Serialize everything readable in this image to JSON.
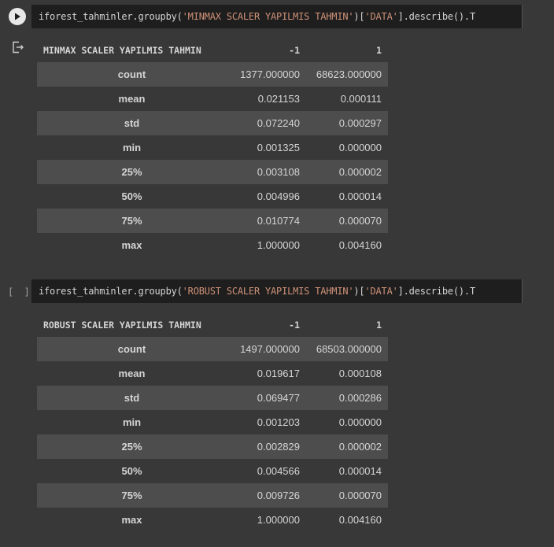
{
  "cells": [
    {
      "code": {
        "prefix": "iforest_tahminler.groupby(",
        "arg1": "'MINMAX SCALER YAPILMIS TAHMIN'",
        "mid": ")[",
        "arg2": "'DATA'",
        "suffix": "].describe().T"
      },
      "run_state": "play",
      "table": {
        "index_name": "MINMAX SCALER YAPILMIS TAHMIN",
        "columns": [
          "-1",
          "1"
        ],
        "rows": [
          {
            "label": "count",
            "v1": "1377.000000",
            "v2": "68623.000000"
          },
          {
            "label": "mean",
            "v1": "0.021153",
            "v2": "0.000111"
          },
          {
            "label": "std",
            "v1": "0.072240",
            "v2": "0.000297"
          },
          {
            "label": "min",
            "v1": "0.001325",
            "v2": "0.000000"
          },
          {
            "label": "25%",
            "v1": "0.003108",
            "v2": "0.000002"
          },
          {
            "label": "50%",
            "v1": "0.004996",
            "v2": "0.000014"
          },
          {
            "label": "75%",
            "v1": "0.010774",
            "v2": "0.000070"
          },
          {
            "label": "max",
            "v1": "1.000000",
            "v2": "0.004160"
          }
        ]
      }
    },
    {
      "code": {
        "prefix": "iforest_tahminler.groupby(",
        "arg1": "'ROBUST SCALER YAPILMIS TAHMIN'",
        "mid": ")[",
        "arg2": "'DATA'",
        "suffix": "].describe().T"
      },
      "run_state": "[ ]",
      "table": {
        "index_name": "ROBUST SCALER YAPILMIS TAHMIN",
        "columns": [
          "-1",
          "1"
        ],
        "rows": [
          {
            "label": "count",
            "v1": "1497.000000",
            "v2": "68503.000000"
          },
          {
            "label": "mean",
            "v1": "0.019617",
            "v2": "0.000108"
          },
          {
            "label": "std",
            "v1": "0.069477",
            "v2": "0.000286"
          },
          {
            "label": "min",
            "v1": "0.001203",
            "v2": "0.000000"
          },
          {
            "label": "25%",
            "v1": "0.002829",
            "v2": "0.000002"
          },
          {
            "label": "50%",
            "v1": "0.004566",
            "v2": "0.000014"
          },
          {
            "label": "75%",
            "v1": "0.009726",
            "v2": "0.000070"
          },
          {
            "label": "max",
            "v1": "1.000000",
            "v2": "0.004160"
          }
        ]
      }
    }
  ]
}
